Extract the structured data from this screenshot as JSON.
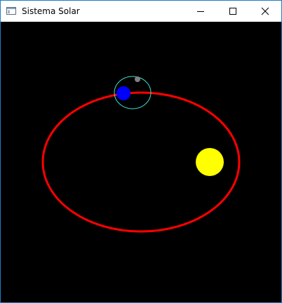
{
  "window": {
    "title": "Sistema Solar",
    "controls": {
      "minimize": "minimize-icon",
      "maximize": "maximize-icon",
      "close": "close-icon"
    }
  },
  "scene": {
    "background": "#000000",
    "sun_color": "#ffff00",
    "earth_color": "#0000ff",
    "earth_orbit_color": "#ff0000",
    "moon_color": "#808080",
    "moon_orbit_color": "#40e0d0"
  }
}
